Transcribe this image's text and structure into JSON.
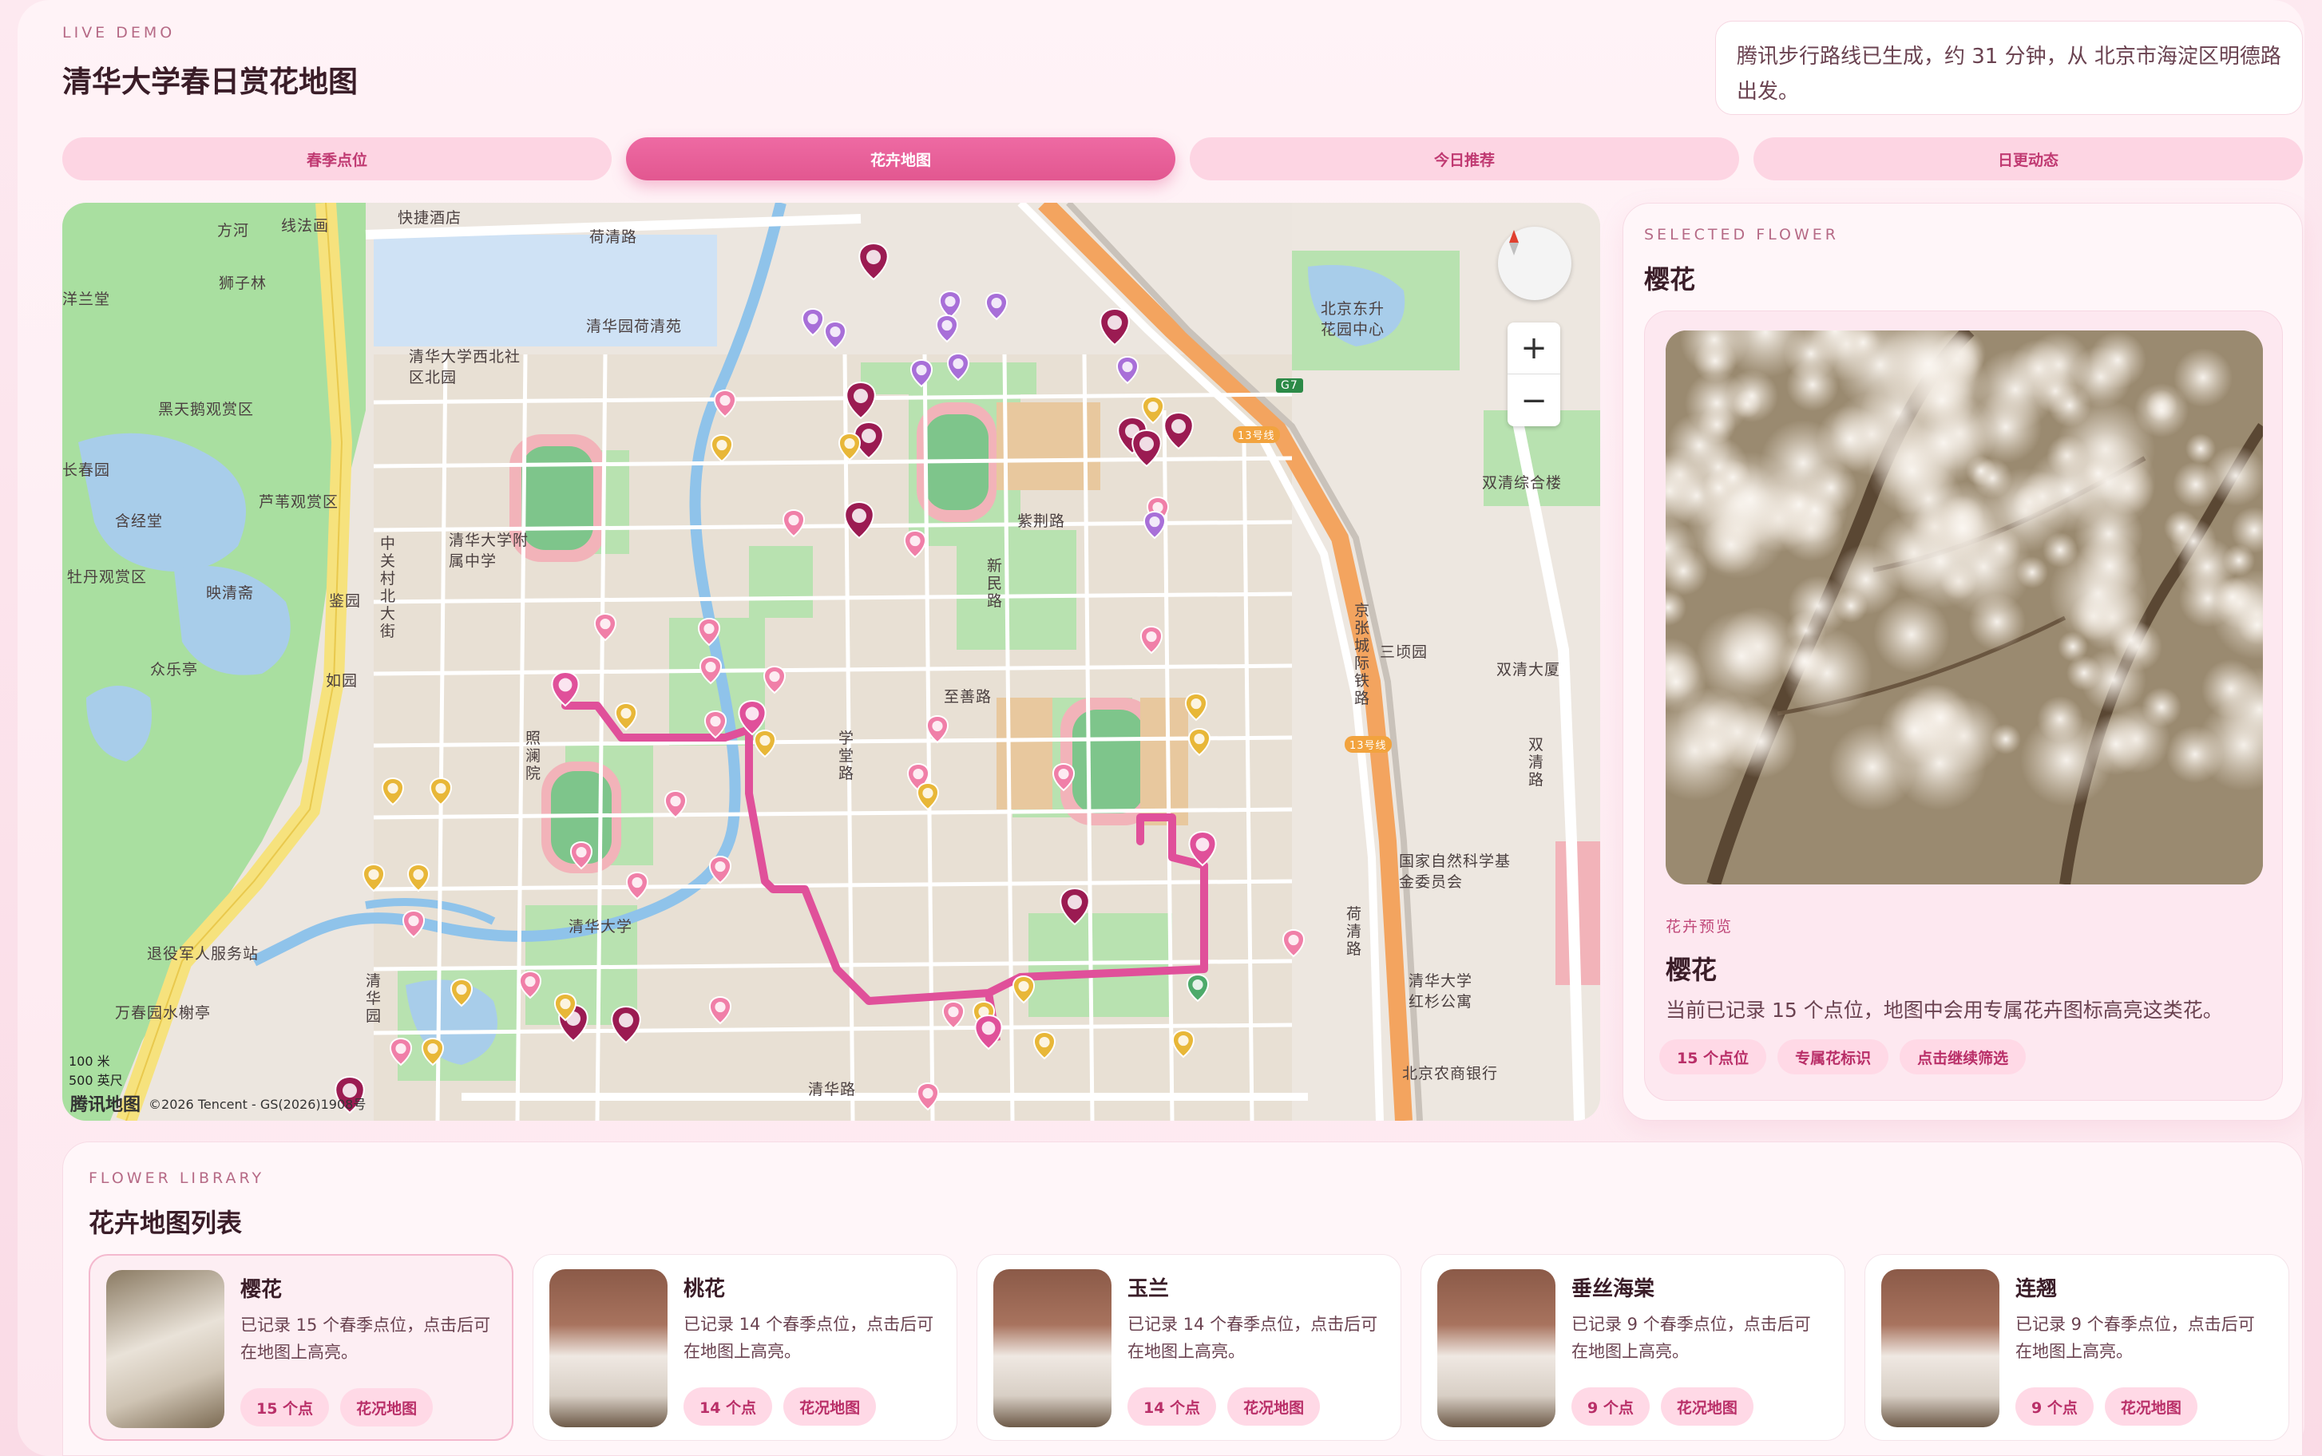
{
  "header": {
    "eyebrow": "LIVE DEMO",
    "title": "清华大学春日赏花地图",
    "status": "腾讯步行路线已生成，约 31 分钟，从 北京市海淀区明德路出发。"
  },
  "tabs": [
    {
      "label": "春季点位",
      "active": false
    },
    {
      "label": "花卉地图",
      "active": true
    },
    {
      "label": "今日推荐",
      "active": false
    },
    {
      "label": "日更动态",
      "active": false
    }
  ],
  "map": {
    "labels": [
      {
        "text": "荷清路",
        "id": "road-heqing"
      },
      {
        "text": "清华园荷清苑",
        "id": "heqingyuan"
      },
      {
        "text": "清华大学西北社区北园",
        "id": "xibei"
      },
      {
        "text": "紫荆路",
        "id": "zijing"
      },
      {
        "text": "清华大学附属中学",
        "id": "fuzhong"
      },
      {
        "text": "新民路",
        "id": "xinmin"
      },
      {
        "text": "至善路",
        "id": "zhishan"
      },
      {
        "text": "学堂路",
        "id": "xuetang"
      },
      {
        "text": "照澜院",
        "id": "zhaolan"
      },
      {
        "text": "清华大学",
        "id": "tsinghua"
      },
      {
        "text": "清华路",
        "id": "qinghua-rd"
      },
      {
        "text": "三顷园",
        "id": "sanqing"
      },
      {
        "text": "双清大厦",
        "id": "shuangqing"
      },
      {
        "text": "双清综合楼",
        "id": "shuangqing-zh"
      },
      {
        "text": "北京东升花园中心",
        "id": "dongsheng"
      },
      {
        "text": "国家自然科学基金委员会",
        "id": "nsfc"
      },
      {
        "text": "清华大学红杉公寓",
        "id": "hongshan"
      },
      {
        "text": "北京农商银行",
        "id": "bank"
      },
      {
        "text": "京张城际铁路",
        "id": "rail"
      },
      {
        "text": "荷清路",
        "id": "heqing2"
      },
      {
        "text": "双清路",
        "id": "shuangqing-rd"
      },
      {
        "text": "方河",
        "id": "fanghe"
      },
      {
        "text": "线法画",
        "id": "xianfa"
      },
      {
        "text": "狮子林",
        "id": "shizilin"
      },
      {
        "text": "洋兰堂",
        "id": "yanglan"
      },
      {
        "text": "快捷酒店",
        "id": "hotel"
      },
      {
        "text": "黑天鹅观赏区",
        "id": "heitiane"
      },
      {
        "text": "长春园",
        "id": "changchun"
      },
      {
        "text": "芦苇观赏区",
        "id": "luwei"
      },
      {
        "text": "含经堂",
        "id": "hanjing"
      },
      {
        "text": "牡丹观赏区",
        "id": "mudan"
      },
      {
        "text": "映清斋",
        "id": "yingqing"
      },
      {
        "text": "鉴园",
        "id": "jianyuan"
      },
      {
        "text": "众乐亭",
        "id": "zhongle"
      },
      {
        "text": "如园",
        "id": "ruyuan"
      },
      {
        "text": "中关村北大街",
        "id": "zgc"
      },
      {
        "text": "退役军人服务站",
        "id": "veteran"
      },
      {
        "text": "万春园水榭亭",
        "id": "wanchun"
      },
      {
        "text": "清华园",
        "id": "qhy"
      }
    ],
    "scale_1": "100 米",
    "scale_2": "500 英尺",
    "attribution_logo": "腾讯地图",
    "attribution_text": "©2026 Tencent - GS(2026)1908号",
    "zoom_in": "+",
    "zoom_out": "−",
    "highway_badge_1": "G7",
    "highway_badge_2": "13号线",
    "highway_badge_3": "13号线",
    "rail_label": "京张城际铁路"
  },
  "selected": {
    "eyebrow": "SELECTED FLOWER",
    "title": "樱花",
    "preview_label": "花卉预览",
    "preview_title": "樱花",
    "preview_desc": "当前已记录 15 个点位，地图中会用专属花卉图标高亮这类花。",
    "chips": [
      "15 个点位",
      "专属花标识",
      "点击继续筛选"
    ]
  },
  "library": {
    "eyebrow": "FLOWER LIBRARY",
    "title": "花卉地图列表",
    "items": [
      {
        "name": "樱花",
        "desc": "已记录 15 个春季点位，点击后可在地图上高亮。",
        "count": "15 个点",
        "tag": "花况地图",
        "selected": true
      },
      {
        "name": "桃花",
        "desc": "已记录 14 个春季点位，点击后可在地图上高亮。",
        "count": "14 个点",
        "tag": "花况地图",
        "selected": false
      },
      {
        "name": "玉兰",
        "desc": "已记录 14 个春季点位，点击后可在地图上高亮。",
        "count": "14 个点",
        "tag": "花况地图",
        "selected": false
      },
      {
        "name": "垂丝海棠",
        "desc": "已记录 9 个春季点位，点击后可在地图上高亮。",
        "count": "9 个点",
        "tag": "花况地图",
        "selected": false
      },
      {
        "name": "连翘",
        "desc": "已记录 9 个春季点位，点击后可在地图上高亮。",
        "count": "9 个点",
        "tag": "花况地图",
        "selected": false
      }
    ]
  },
  "colors": {
    "accent": "#e25790",
    "route": "#e0509a",
    "marker_cherry": "#9b1b52",
    "marker_peach": "#f07fa8",
    "marker_magnolia": "#e8b738",
    "marker_crabapple": "#a86fd8",
    "marker_forsythia": "#4daa6a"
  }
}
